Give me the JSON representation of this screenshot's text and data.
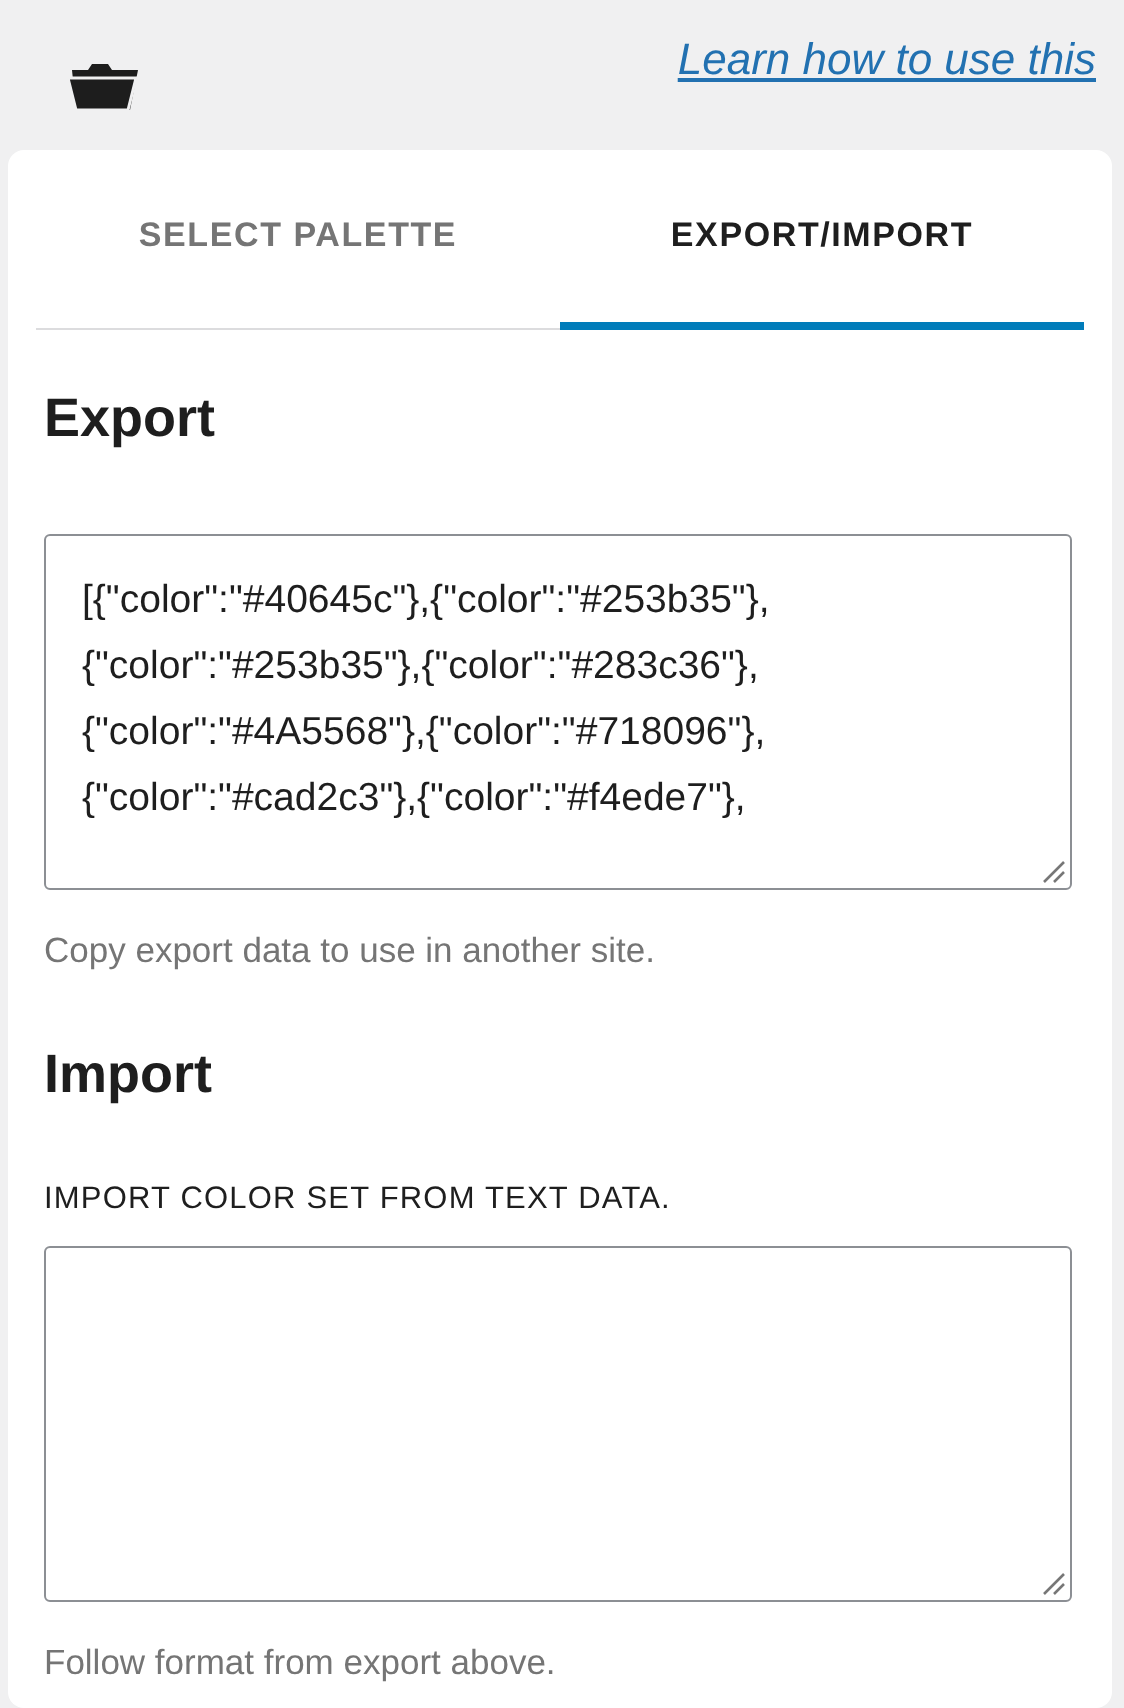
{
  "header": {
    "link": "Learn how to use this"
  },
  "tabs": [
    {
      "label": "SELECT PALETTE",
      "selected": false
    },
    {
      "label": "EXPORT/IMPORT",
      "selected": true
    }
  ],
  "export": {
    "heading": "Export",
    "value": "[{\"color\":\"#40645c\"},{\"color\":\"#253b35\"},\n{\"color\":\"#253b35\"},{\"color\":\"#283c36\"},\n{\"color\":\"#4A5568\"},{\"color\":\"#718096\"},\n{\"color\":\"#cad2c3\"},{\"color\":\"#f4ede7\"},",
    "help": "Copy export data to use in another site."
  },
  "import": {
    "heading": "Import",
    "label": "IMPORT COLOR SET FROM TEXT DATA.",
    "help": "Follow format from export above."
  }
}
